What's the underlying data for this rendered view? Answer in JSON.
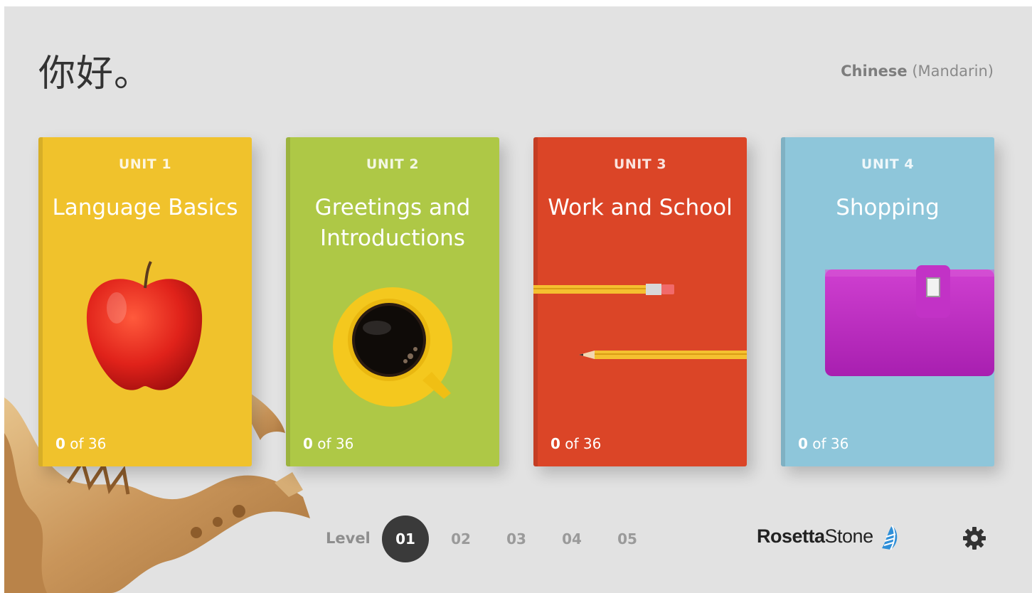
{
  "header": {
    "greeting": "你好。",
    "language_bold": "Chinese",
    "language_rest": "(Mandarin)"
  },
  "units": [
    {
      "label": "UNIT 1",
      "title": "Language Basics",
      "completed": "0",
      "total_text": "of 36",
      "color": "#f0c22c",
      "art": "apple"
    },
    {
      "label": "UNIT 2",
      "title": "Greetings and Introductions",
      "completed": "0",
      "total_text": "of 36",
      "color": "#aec846",
      "art": "coffee-cup"
    },
    {
      "label": "UNIT 3",
      "title": "Work and School",
      "completed": "0",
      "total_text": "of 36",
      "color": "#db4527",
      "art": "pencils"
    },
    {
      "label": "UNIT 4",
      "title": "Shopping",
      "completed": "0",
      "total_text": "of 36",
      "color": "#8ec6da",
      "art": "wallet"
    }
  ],
  "levels": {
    "label": "Level",
    "items": [
      "01",
      "02",
      "03",
      "04",
      "05"
    ],
    "selected": "01"
  },
  "brand": {
    "part1": "Rosetta",
    "part2": "Stone"
  },
  "icons": {
    "settings": "gear-icon",
    "logo": "rosetta-stone-logo-icon",
    "decoration": "dragon-statue"
  }
}
